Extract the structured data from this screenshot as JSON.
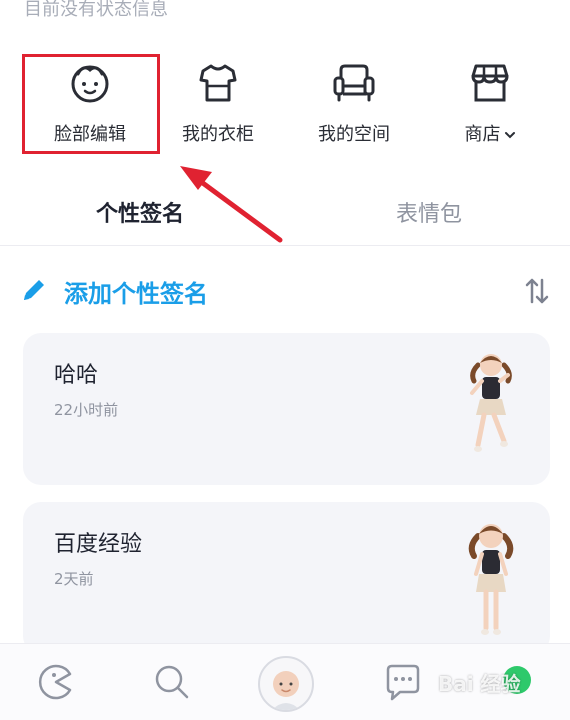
{
  "status": {
    "text": "目前没有状态信息"
  },
  "features": [
    {
      "label": "脸部编辑",
      "icon": "face-icon"
    },
    {
      "label": "我的衣柜",
      "icon": "shirt-icon"
    },
    {
      "label": "我的空间",
      "icon": "sofa-icon"
    },
    {
      "label": "商店",
      "icon": "store-icon",
      "suffix": "chevron-down-icon"
    }
  ],
  "tabs": [
    {
      "label": "个性签名",
      "active": true
    },
    {
      "label": "表情包",
      "active": false
    }
  ],
  "signature": {
    "add_label": "添加个性签名",
    "icon": "pencil-icon",
    "sort_icon": "sort-icon"
  },
  "cards": [
    {
      "title": "哈哈",
      "time": "22小时前"
    },
    {
      "title": "百度经验",
      "time": "2天前"
    }
  ],
  "bottom_nav": {
    "items": [
      "pacman-icon",
      "search-icon",
      "avatar",
      "chat-icon",
      "notification-dot"
    ]
  },
  "watermark": {
    "text": "Bai 经验"
  },
  "colors": {
    "accent": "#1a9ee8",
    "highlight": "#e02231",
    "card_bg": "#f4f5f9",
    "badge": "#2ec96b"
  }
}
